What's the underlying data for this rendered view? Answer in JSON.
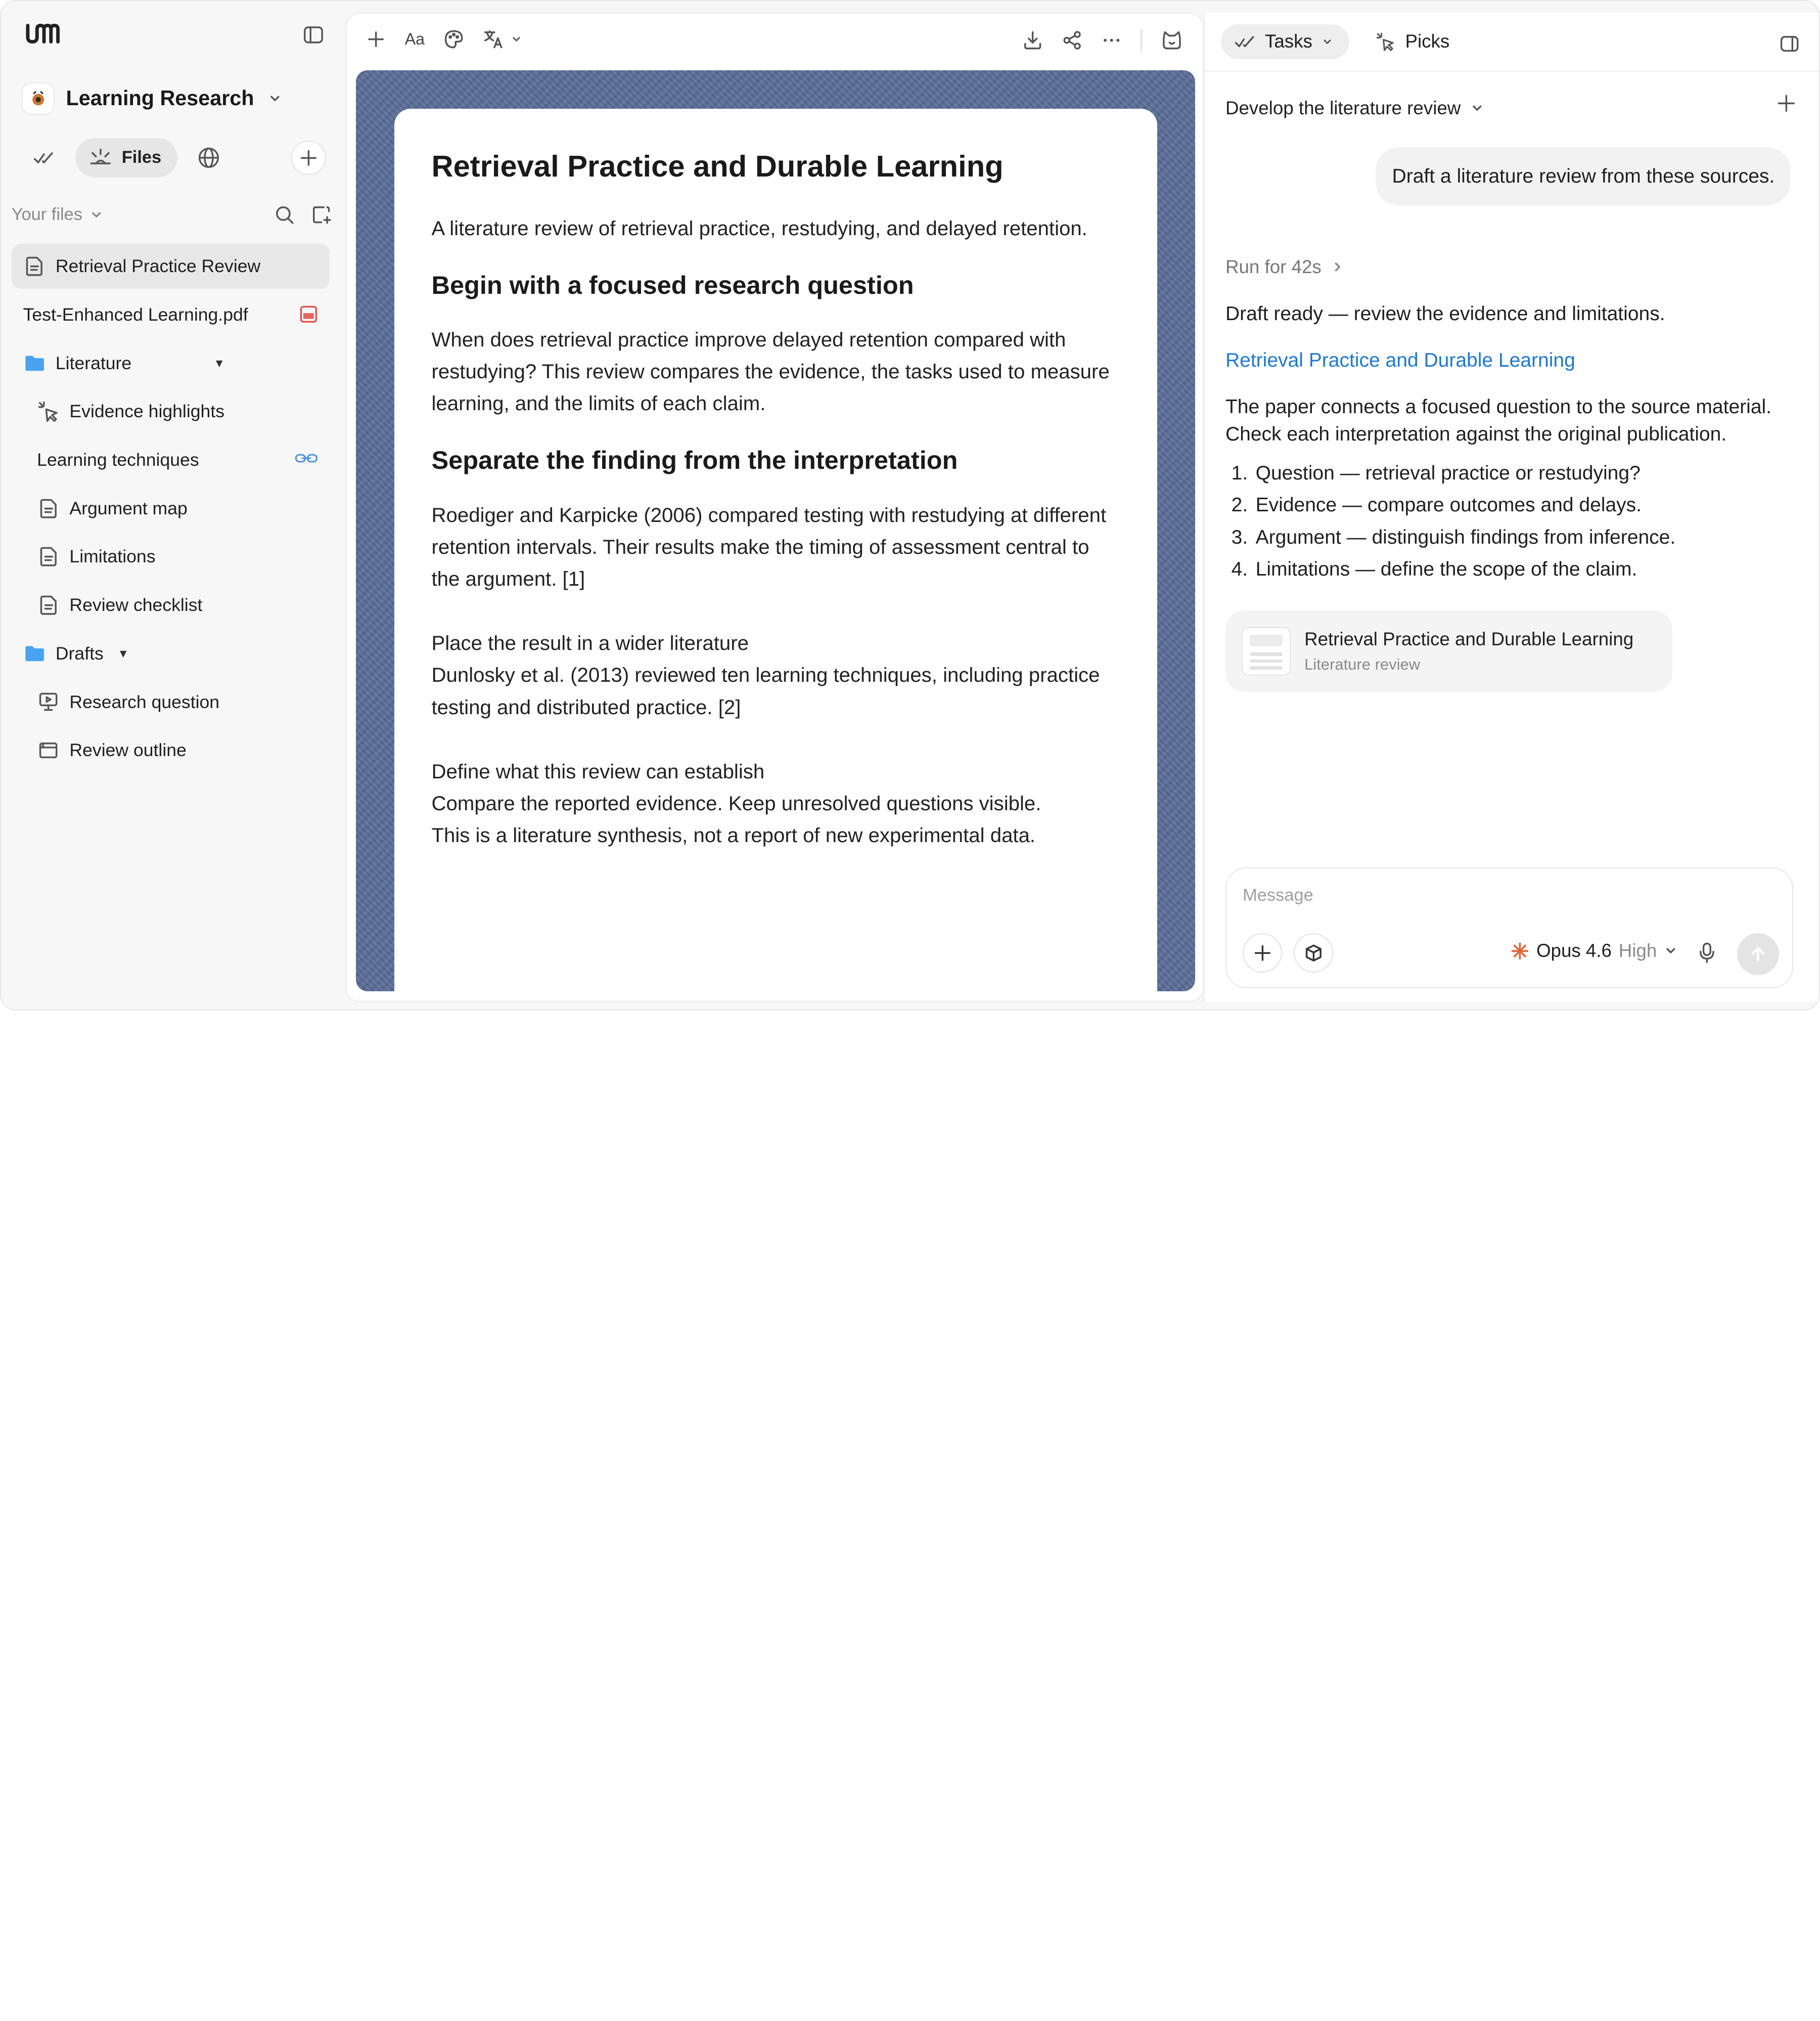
{
  "sidebar": {
    "workspace_name": "Learning Research",
    "files_tab_label": "Files",
    "your_files_label": "Your files",
    "items": [
      {
        "label": "Retrieval Practice Review",
        "icon": "doc-icon"
      },
      {
        "label": "Test-Enhanced Learning.pdf",
        "icon": "pdf-icon"
      },
      {
        "label": "Literature",
        "icon": "folder-icon"
      },
      {
        "label": "Evidence highlights",
        "icon": "pointer-click-icon"
      },
      {
        "label": "Learning techniques",
        "icon": "link-icon"
      },
      {
        "label": "Argument map",
        "icon": "doc-icon"
      },
      {
        "label": "Limitations",
        "icon": "doc-icon"
      },
      {
        "label": "Review checklist",
        "icon": "doc-icon"
      },
      {
        "label": "Drafts",
        "icon": "folder-icon"
      },
      {
        "label": "Research question",
        "icon": "presentation-icon"
      },
      {
        "label": "Review outline",
        "icon": "window-icon"
      }
    ]
  },
  "toolbar": {
    "font_label": "Aa"
  },
  "document": {
    "title": "Retrieval Practice and Durable Learning",
    "subtitle": "A literature review of retrieval practice, restudying, and delayed retention.",
    "h2_1": "Begin with a focused research question",
    "p1": "When does retrieval practice improve delayed retention compared with restudying? This review compares the evidence, the tasks used to measure learning, and the limits of each claim.",
    "h2_2": "Separate the finding from the interpretation",
    "p2": "Roediger and Karpicke (2006) compared testing with restudying at different retention intervals. Their results make the timing of assessment central to the argument. [1]",
    "p3_heading": "Place the result in a wider literature",
    "p3": "Dunlosky et al. (2013) reviewed ten learning techniques, including practice testing and distributed practice. [2]",
    "p4_heading": "Define what this review can establish",
    "p4a": "Compare the reported evidence. Keep unresolved questions visible.",
    "p4b": "This is a literature synthesis, not a report of new experimental data."
  },
  "panel": {
    "tabs": [
      "Tasks",
      "Picks"
    ],
    "task_title": "Develop the literature review",
    "user_message": "Draft a literature review from these sources.",
    "run_for": "Run for 42s",
    "reply_line1": "Draft ready — review the evidence and limitations.",
    "reply_link": "Retrieval Practice and Durable Learning",
    "reply_para": "The paper connects a focused question to the source material. Check each interpretation against the original publication.",
    "reply_list": [
      "Question — retrieval practice or restudying?",
      "Evidence — compare outcomes and delays.",
      "Argument — distinguish findings from inference.",
      "Limitations — define the scope of the claim."
    ],
    "attachment_title": "Retrieval Practice and Durable Learning",
    "attachment_subtitle": "Literature review",
    "composer_placeholder": "Message",
    "model_name": "Opus 4.6",
    "model_level": "High"
  },
  "colors": {
    "accent_link": "#1f78d1",
    "canvas_bg": "#5a6d97",
    "folder": "#4aa3f0",
    "pdf": "#e24b4b"
  }
}
